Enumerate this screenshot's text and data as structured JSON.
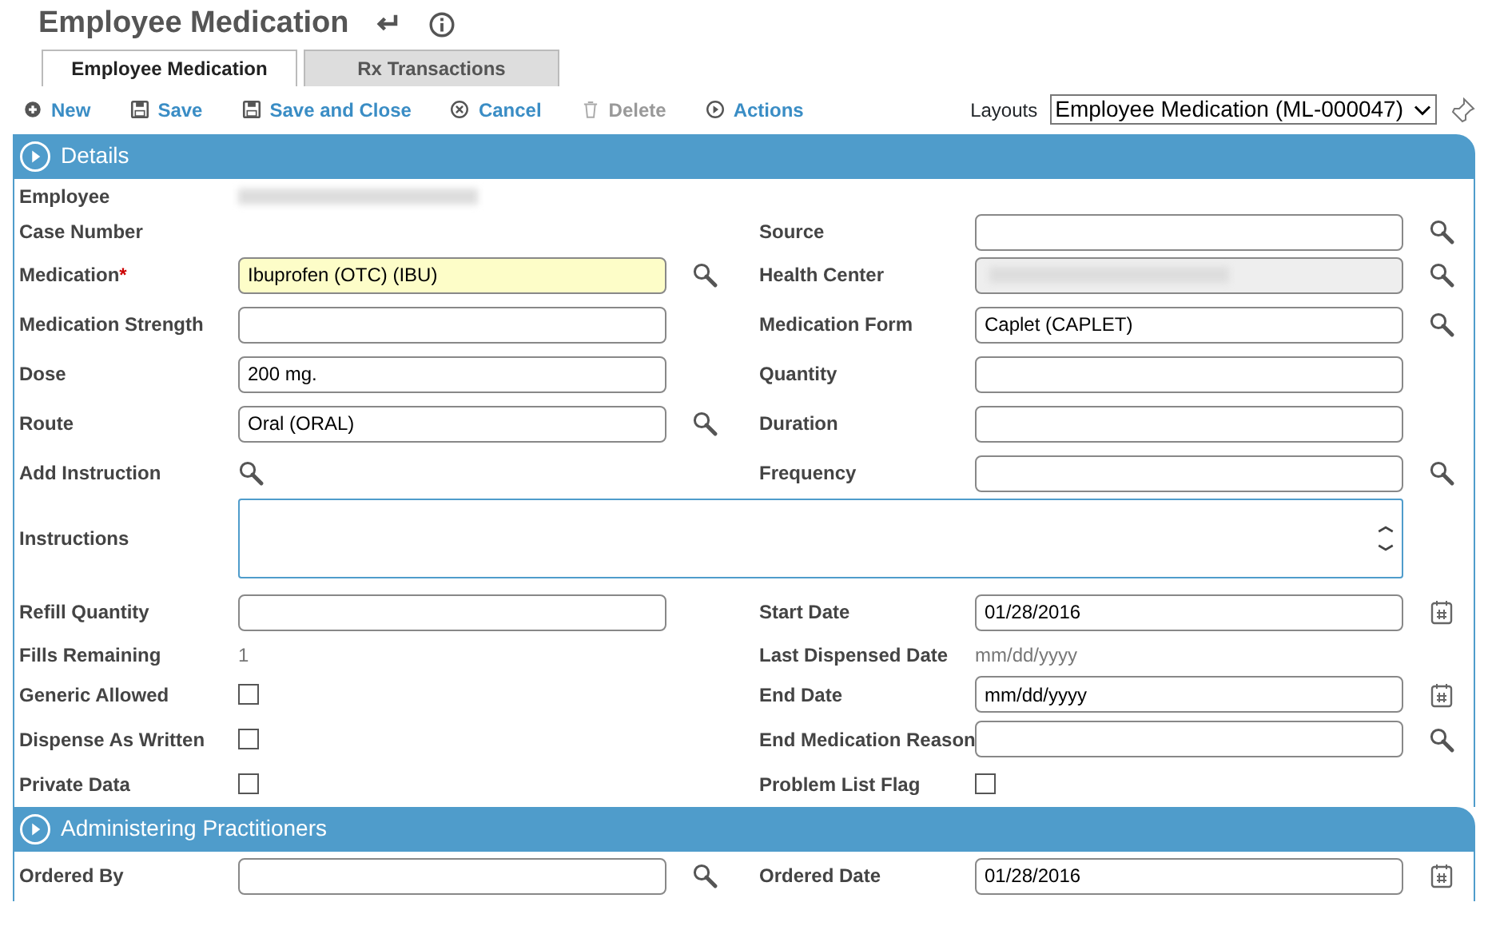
{
  "page": {
    "title": "Employee Medication"
  },
  "tabs": [
    {
      "label": "Employee Medication",
      "selected": true
    },
    {
      "label": "Rx Transactions",
      "selected": false
    }
  ],
  "toolbar": {
    "buttons": [
      {
        "label": "New",
        "kind": "new",
        "disabled": false
      },
      {
        "label": "Save",
        "kind": "save",
        "disabled": false
      },
      {
        "label": "Save and Close",
        "kind": "save",
        "disabled": false
      },
      {
        "label": "Cancel",
        "kind": "cancel",
        "disabled": false
      },
      {
        "label": "Delete",
        "kind": "delete",
        "disabled": true
      },
      {
        "label": "Actions",
        "kind": "actions",
        "disabled": false
      }
    ],
    "layouts_label": "Layouts",
    "layouts_value": "Employee Medication (ML-000047)"
  },
  "sections": [
    {
      "title": "Details",
      "rows": [
        {
          "left": {
            "label": "Employee",
            "kind": "redacted"
          }
        },
        {
          "left": {
            "label": "Case Number",
            "kind": "none"
          },
          "right": {
            "label": "Source",
            "kind": "lookup"
          }
        },
        {
          "left": {
            "label": "Medication",
            "kind": "lookup",
            "value": "Ibuprofen (OTC) (IBU)",
            "required": true,
            "required_mark": "*"
          },
          "right": {
            "label": "Health Center",
            "kind": "redacted-lookup"
          }
        },
        {
          "left": {
            "label": "Medication Strength",
            "kind": "text"
          },
          "right": {
            "label": "Medication Form",
            "kind": "lookup",
            "value": "Caplet (CAPLET)"
          }
        },
        {
          "left": {
            "label": "Dose",
            "kind": "text",
            "value": "200 mg."
          },
          "right": {
            "label": "Quantity",
            "kind": "text"
          }
        },
        {
          "left": {
            "label": "Route",
            "kind": "lookup",
            "value": "Oral (ORAL)"
          },
          "right": {
            "label": "Duration",
            "kind": "text"
          }
        },
        {
          "left": {
            "label": "Add Instruction",
            "kind": "search-only"
          },
          "right": {
            "label": "Frequency",
            "kind": "lookup"
          }
        },
        {
          "wide": {
            "label": "Instructions",
            "kind": "textarea"
          }
        },
        {
          "left": {
            "label": "Refill Quantity",
            "kind": "text"
          },
          "right": {
            "label": "Start Date",
            "kind": "date",
            "value": "01/28/2016"
          }
        },
        {
          "left": {
            "label": "Fills Remaining",
            "kind": "plain",
            "value": "1"
          },
          "right": {
            "label": "Last Dispensed Date",
            "kind": "plain",
            "placeholder": "mm/dd/yyyy"
          }
        },
        {
          "left": {
            "label": "Generic Allowed",
            "kind": "checkbox",
            "checked": false
          },
          "right": {
            "label": "End Date",
            "kind": "date",
            "value": "mm/dd/yyyy"
          }
        },
        {
          "left": {
            "label": "Dispense As Written",
            "kind": "checkbox",
            "checked": false
          },
          "right": {
            "label": "End Medication Reason",
            "kind": "lookup"
          }
        },
        {
          "left": {
            "label": "Private Data",
            "kind": "checkbox",
            "checked": false
          },
          "right": {
            "label": "Problem List Flag",
            "kind": "checkbox",
            "checked": false
          }
        }
      ]
    },
    {
      "title": "Administering Practitioners",
      "rows": [
        {
          "left": {
            "label": "Ordered By",
            "kind": "lookup"
          },
          "right": {
            "label": "Ordered Date",
            "kind": "date",
            "value": "01/28/2016"
          }
        }
      ]
    }
  ]
}
